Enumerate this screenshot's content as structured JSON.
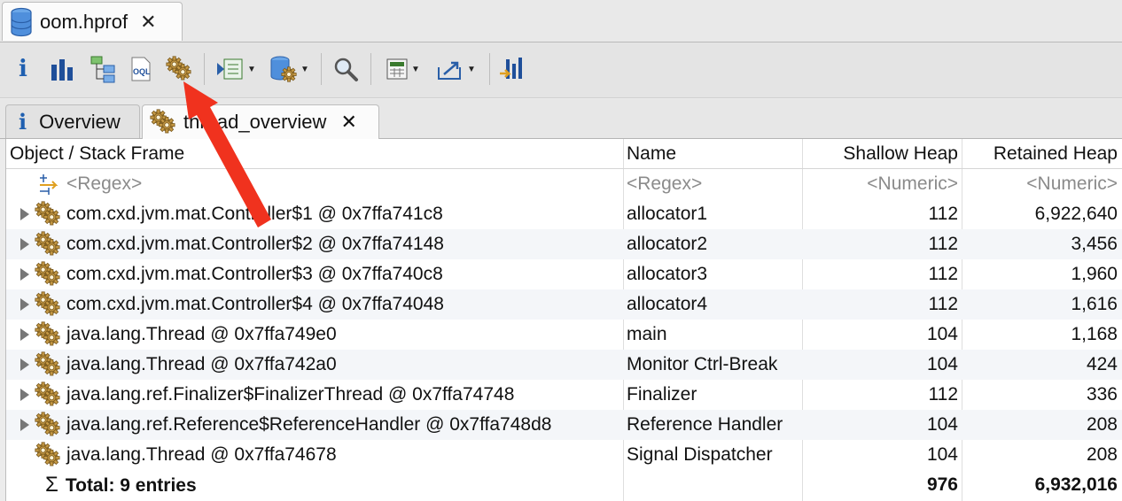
{
  "editor_tab": {
    "title": "oom.hprof"
  },
  "inner_tabs": {
    "overview": "Overview",
    "active": "thread_overview"
  },
  "table": {
    "columns": [
      "Object / Stack Frame",
      "Name",
      "Shallow Heap",
      "Retained Heap"
    ],
    "filter": {
      "object": "<Regex>",
      "name": "<Regex>",
      "shallow": "<Numeric>",
      "retained": "<Numeric>"
    },
    "rows": [
      {
        "object": "com.cxd.jvm.mat.Controller$1 @ 0x7ffa741c8",
        "name": "allocator1",
        "shallow": "112",
        "retained": "6,922,640",
        "expandable": true
      },
      {
        "object": "com.cxd.jvm.mat.Controller$2 @ 0x7ffa74148",
        "name": "allocator2",
        "shallow": "112",
        "retained": "3,456",
        "expandable": true
      },
      {
        "object": "com.cxd.jvm.mat.Controller$3 @ 0x7ffa740c8",
        "name": "allocator3",
        "shallow": "112",
        "retained": "1,960",
        "expandable": true
      },
      {
        "object": "com.cxd.jvm.mat.Controller$4 @ 0x7ffa74048",
        "name": "allocator4",
        "shallow": "112",
        "retained": "1,616",
        "expandable": true
      },
      {
        "object": "java.lang.Thread @ 0x7ffa749e0",
        "name": "main",
        "shallow": "104",
        "retained": "1,168",
        "expandable": true
      },
      {
        "object": "java.lang.Thread @ 0x7ffa742a0",
        "name": "Monitor Ctrl-Break",
        "shallow": "104",
        "retained": "424",
        "expandable": true
      },
      {
        "object": "java.lang.ref.Finalizer$FinalizerThread @ 0x7ffa74748",
        "name": "Finalizer",
        "shallow": "112",
        "retained": "336",
        "expandable": true
      },
      {
        "object": "java.lang.ref.Reference$ReferenceHandler @ 0x7ffa748d8",
        "name": "Reference Handler",
        "shallow": "104",
        "retained": "208",
        "expandable": true
      },
      {
        "object": "java.lang.Thread @ 0x7ffa74678",
        "name": "Signal Dispatcher",
        "shallow": "104",
        "retained": "208",
        "expandable": false
      }
    ],
    "total": {
      "label": "Total: 9 entries",
      "shallow": "976",
      "retained": "6,932,016"
    }
  },
  "colors": {
    "annotation_arrow": "#f0321e",
    "row_alt": "#f4f6f9"
  }
}
